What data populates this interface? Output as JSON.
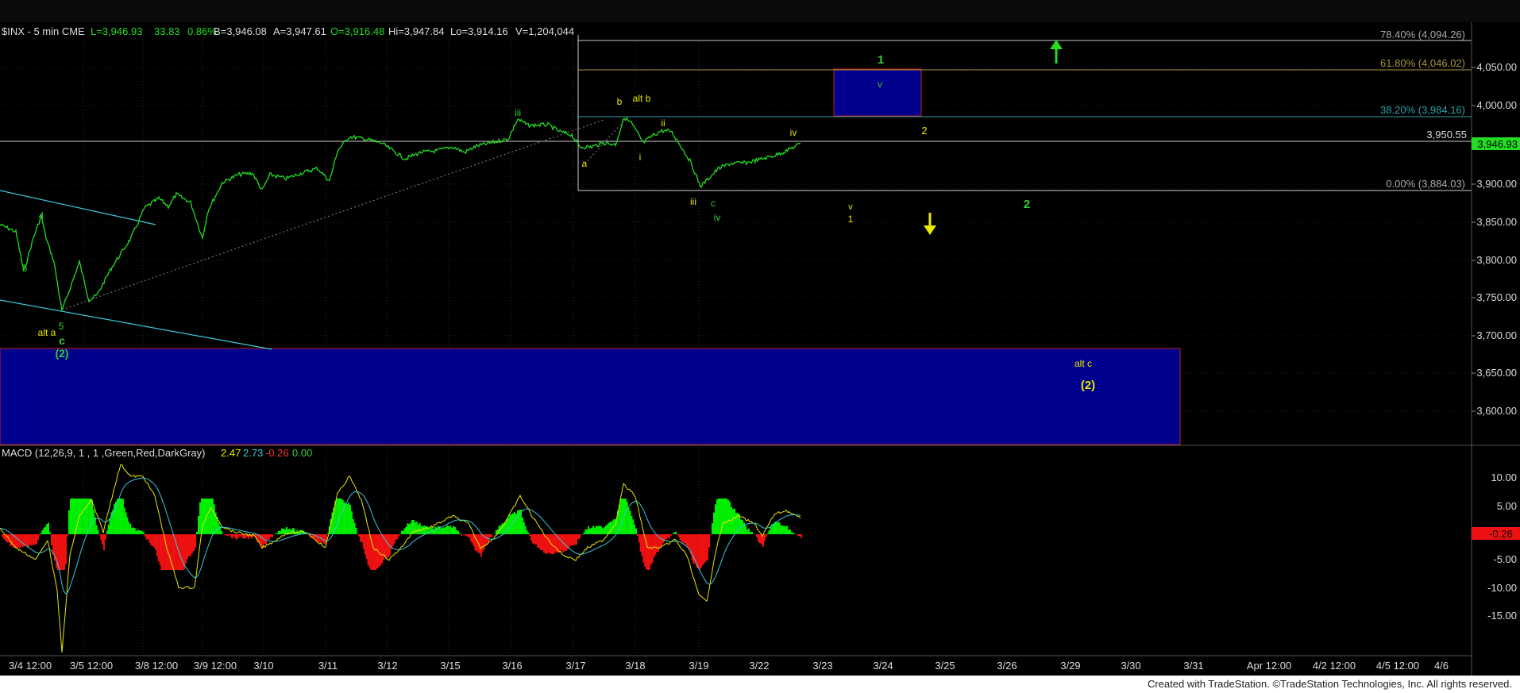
{
  "header": {
    "symbol": "$INX - 5 min  CME",
    "last": "L=3,946.93",
    "change": "33.83",
    "change_pct": "0.86%",
    "bid": "B=3,946.08",
    "ask": "A=3,947.61",
    "open": "O=3,916.48",
    "high": "Hi=3,947.84",
    "low": "Lo=3,914.16",
    "volume": "V=1,204,044"
  },
  "macd_header": {
    "label": "MACD (12,26,9, 1 , 1 ,Green,Red,DarkGray)",
    "macd_value": "2.47",
    "signal_value": "2.73",
    "diff_value": "-0.26",
    "zero_value": "0.00"
  },
  "footer": {
    "text": "Created with TradeStation. ©TradeStation Technologies, Inc. All rights reserved."
  },
  "colors": {
    "price_line": "#22dd22",
    "wave_green": "#33cc33",
    "wave_yellow": "#e8e800",
    "trend_cyan": "#3cc8d8",
    "target_box": "#00008c",
    "macd_pos": "#00ee00",
    "macd_neg": "#ee1111",
    "signal": "#e8e800"
  },
  "price_axis": {
    "ticks": [
      "4,050.00",
      "4,000.00",
      "3,950.00",
      "3,900.00",
      "3,850.00",
      "3,800.00",
      "3,750.00",
      "3,700.00",
      "3,650.00",
      "3,600.00"
    ],
    "level_3950": "3,950.55",
    "last_price": "3,946.93"
  },
  "macd_axis": {
    "ticks": [
      "10.00",
      "5.00",
      "-5.00",
      "-10.00",
      "-15.00"
    ],
    "last_diff": "-0.26"
  },
  "fib": {
    "top_label": "78.40% (4,094.26)",
    "fib_618": "61.80% (4,046.02)",
    "fib_382": "38.20% (3,984.16)",
    "fib_0": "0.00% (3,884.03)"
  },
  "date_axis": [
    "3/4 12:00",
    "3/5 12:00",
    "3/8 12:00",
    "3/9 12:00",
    "3/10",
    "3/11",
    "3/12",
    "3/15",
    "3/16",
    "3/17",
    "3/18",
    "3/19",
    "3/22",
    "3/23",
    "3/24",
    "3/25",
    "3/26",
    "3/29",
    "3/30",
    "3/31",
    "Apr 12:00",
    "4/2 12:00",
    "4/5 12:00",
    "4/6"
  ],
  "wave_labels": {
    "g4": "4",
    "g3": "3",
    "g5": "5",
    "gc": "c",
    "g2paren": "(2)",
    "y_alt_a": "alt a",
    "g_iii_top": "iii",
    "y_b": "b",
    "y_alt_b": "alt b",
    "y_a": "a",
    "y_ii": "ii",
    "y_i": "i",
    "y_iii_bot": "iii",
    "g_c": "c",
    "g_iv": "iv",
    "y_iv": "iv",
    "g_1_top": "1",
    "g_v_box": "v",
    "y_2": "2",
    "y_v": "v",
    "y_1": "1",
    "g_2": "2",
    "y_alt_c": "alt c",
    "y_2paren": "(2)"
  },
  "chart_data": {
    "type": "line",
    "title": "$INX - 5 min",
    "x": [
      "3/4 12:00",
      "3/5 12:00",
      "3/8 12:00",
      "3/9 12:00",
      "3/10",
      "3/11",
      "3/12",
      "3/15",
      "3/16",
      "3/17",
      "3/18",
      "3/19",
      "3/22"
    ],
    "series": [
      {
        "name": "$INX",
        "values": [
          3840,
          3730,
          3870,
          3850,
          3880,
          3935,
          3920,
          3950,
          3970,
          3950,
          3945,
          3880,
          3946.93
        ]
      },
      {
        "name": "MACD",
        "values": [
          -5,
          -20,
          12,
          3,
          -4,
          8,
          -5,
          4,
          9,
          -2,
          6,
          -13,
          2.47
        ]
      }
    ],
    "ylim": [
      3550,
      4100
    ],
    "levels": {
      "fib_78_4": 4094.26,
      "fib_61_8": 4046.02,
      "fib_38_2": 3984.16,
      "fib_0": 3884.03,
      "horizontal": 3950.55
    },
    "macd_ylim": [
      -20,
      13
    ],
    "grid": true
  }
}
